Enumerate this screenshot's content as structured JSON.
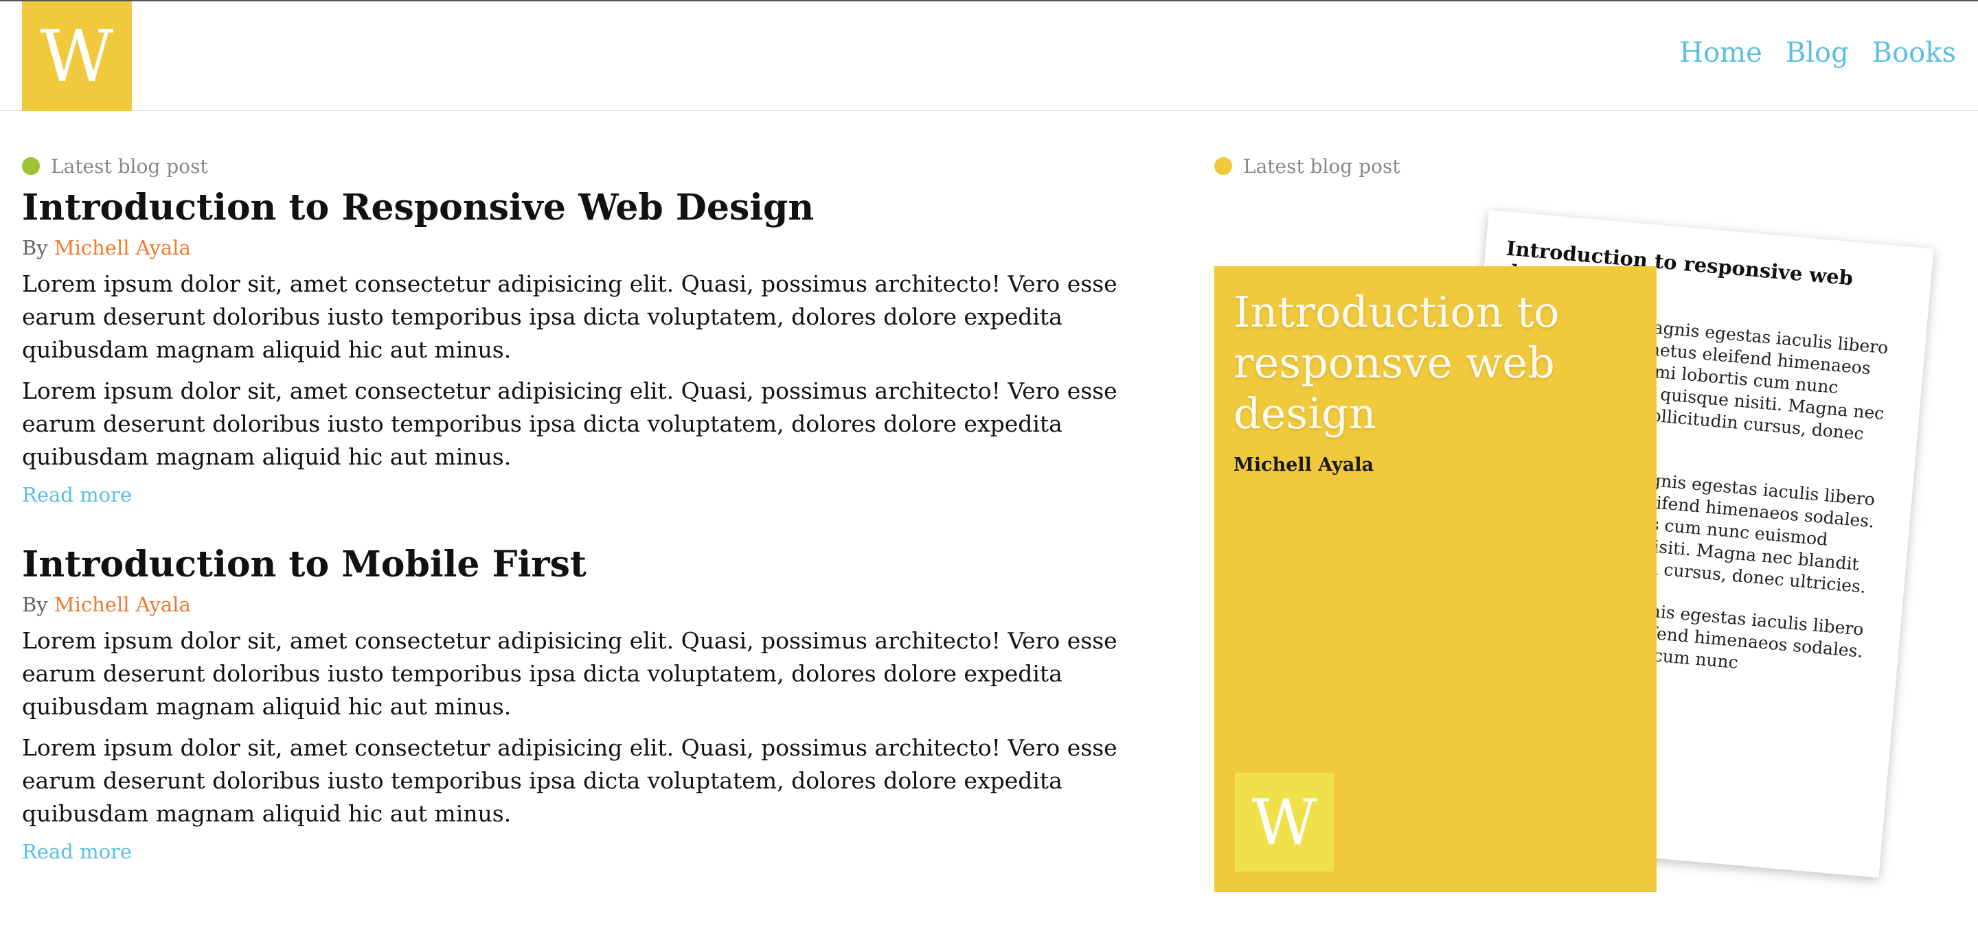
{
  "header": {
    "logo_letter": "W",
    "nav": [
      "Home",
      "Blog",
      "Books"
    ]
  },
  "posts_section": {
    "tag_label": "Latest blog post",
    "tag_color": "#9bc333",
    "posts": [
      {
        "title": "Introduction to Responsive Web Design",
        "by_label": "By",
        "author": "Michell Ayala",
        "paragraphs": [
          "Lorem ipsum dolor sit, amet consectetur adipisicing elit. Quasi, possimus architecto! Vero esse earum deserunt doloribus iusto temporibus ipsa dicta voluptatem, dolores dolore expedita quibusdam magnam aliquid hic aut minus.",
          "Lorem ipsum dolor sit, amet consectetur adipisicing elit. Quasi, possimus architecto! Vero esse earum deserunt doloribus iusto temporibus ipsa dicta voluptatem, dolores dolore expedita quibusdam magnam aliquid hic aut minus."
        ],
        "read_more": "Read more"
      },
      {
        "title": "Introduction to Mobile First",
        "by_label": "By",
        "author": "Michell Ayala",
        "paragraphs": [
          "Lorem ipsum dolor sit, amet consectetur adipisicing elit. Quasi, possimus architecto! Vero esse earum deserunt doloribus iusto temporibus ipsa dicta voluptatem, dolores dolore expedita quibusdam magnam aliquid hic aut minus.",
          "Lorem ipsum dolor sit, amet consectetur adipisicing elit. Quasi, possimus architecto! Vero esse earum deserunt doloribus iusto temporibus ipsa dicta voluptatem, dolores dolore expedita quibusdam magnam aliquid hic aut minus."
        ],
        "read_more": "Read more"
      }
    ]
  },
  "book_section": {
    "tag_label": "Latest blog post",
    "tag_color": "#f0c93c",
    "paper": {
      "title": "Introduction to responsive web design",
      "paragraphs": [
        "Tortor hac erat magnis egestas iaculis libero tellus accumsan metus eleifend himenaeos sodales. Praesent mi lobortis cum nunc euismod phasellus quisque nisiti. Magna nec blandit per diam sollicitudin cursus, donec ultricies.",
        "Tortor hac erat magnis egestas iaculis libero tellus accumsan eleifend himenaeos sodales. Praesent mi lobortis cum nunc euismod phasellus quisque nisiti. Magna nec blandit per diam sollicitudin cursus, donec ultricies.",
        "Tortor hac erat magnis egestas iaculis libero tellus accumsan eleifend himenaeos sodales. Praesent mi lobortis cum nunc"
      ]
    },
    "cover": {
      "title": "Introduction to responsve web design",
      "author": "Michell Ayala",
      "logo_letter": "W"
    }
  }
}
